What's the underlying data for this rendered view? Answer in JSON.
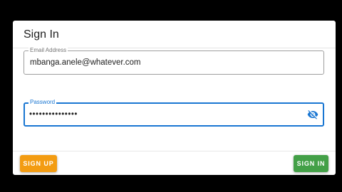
{
  "dialog": {
    "title": "Sign In"
  },
  "email": {
    "label": "Email Address",
    "value": "mbanga.anele@whatever.com"
  },
  "password": {
    "label": "Password",
    "value": "•••••••••••••••",
    "toggle_icon": "eye-off-icon"
  },
  "actions": {
    "sign_up_label": "SIGN UP",
    "sign_in_label": "SIGN IN"
  },
  "colors": {
    "focus_accent": "#1976d2",
    "sign_up_button": "#f39c12",
    "sign_in_button": "#43a047"
  }
}
